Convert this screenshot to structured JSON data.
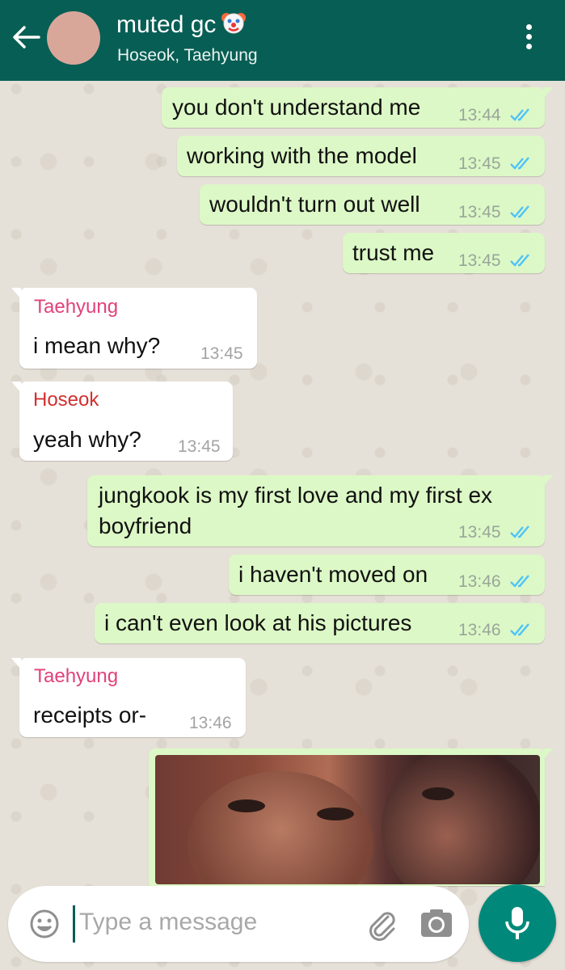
{
  "header": {
    "title": "muted gc",
    "participants": "Hoseok, Taehyung"
  },
  "messages": [
    {
      "dir": "out",
      "text": "you don't understand me",
      "time": "13:44"
    },
    {
      "dir": "out",
      "text": "working with the model",
      "time": "13:45"
    },
    {
      "dir": "out",
      "text": "wouldn't turn out well",
      "time": "13:45"
    },
    {
      "dir": "out",
      "text": "trust me",
      "time": "13:45"
    },
    {
      "dir": "in",
      "sender": "Taehyung",
      "sender_color": "#e0427a",
      "text": "i mean why?",
      "time": "13:45"
    },
    {
      "dir": "in",
      "sender": "Hoseok",
      "sender_color": "#d32f2f",
      "text": "yeah why?",
      "time": "13:45"
    },
    {
      "dir": "out",
      "text": "jungkook is my first love and my first ex boyfriend",
      "time": "13:45"
    },
    {
      "dir": "out",
      "text": "i haven't moved on",
      "time": "13:46"
    },
    {
      "dir": "out",
      "text": "i can't even look at his pictures",
      "time": "13:46"
    },
    {
      "dir": "in",
      "sender": "Taehyung",
      "sender_color": "#e0427a",
      "text": "receipts or-",
      "time": "13:46"
    },
    {
      "dir": "out",
      "type": "image"
    }
  ],
  "composer": {
    "placeholder": "Type a message"
  },
  "colors": {
    "header": "#075e54",
    "outgoing": "#dcf8c6",
    "incoming": "#ffffff",
    "read_ticks": "#4fc3f7",
    "mic_button": "#00897b"
  },
  "icons": [
    "back-arrow-icon",
    "clown-emoji-icon",
    "menu-dots-icon",
    "double-check-icon",
    "emoji-icon",
    "paperclip-icon",
    "camera-icon",
    "microphone-icon"
  ]
}
